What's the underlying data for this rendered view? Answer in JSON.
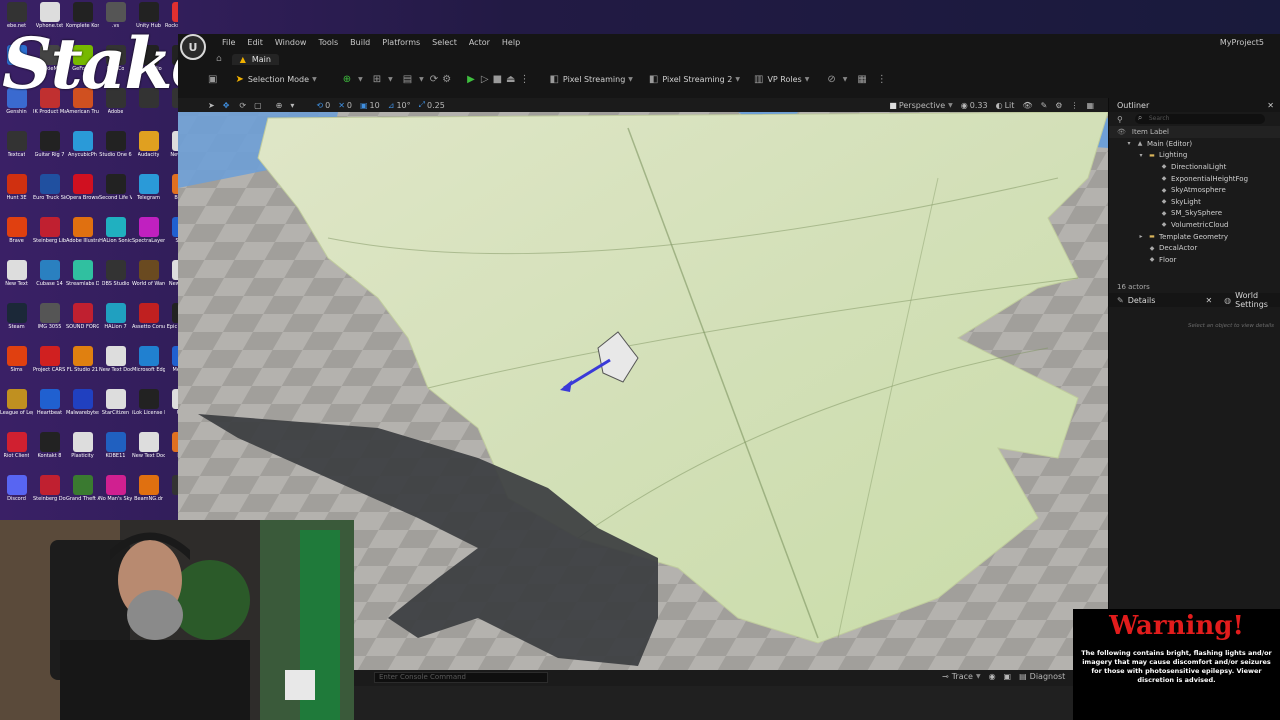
{
  "desktop": {
    "icons": [
      {
        "label": "ebe.net",
        "color": "#333"
      },
      {
        "label": "Vphone.txt",
        "color": "#ddd"
      },
      {
        "label": "Komplete Kontrol",
        "color": "#222"
      },
      {
        "label": ".vs",
        "color": "#555"
      },
      {
        "label": "Unity Hub",
        "color": "#222"
      },
      {
        "label": "Rockstar Games",
        "color": "#e03030"
      },
      {
        "label": "",
        "color": "#2a6fd0"
      },
      {
        "label": "DeskieMin",
        "color": "#444"
      },
      {
        "label": "GeForce",
        "color": "#76b900"
      },
      {
        "label": "DTMCo",
        "color": "#333"
      },
      {
        "label": "GPU Audio",
        "color": "#222"
      },
      {
        "label": "",
        "color": "#222"
      },
      {
        "label": "Genshin",
        "color": "#3a6ad0"
      },
      {
        "label": "IK Product Manager",
        "color": "#c03030"
      },
      {
        "label": "American Truck Si",
        "color": "#d05020"
      },
      {
        "label": "Adobe",
        "color": "#333"
      },
      {
        "label": "",
        "color": "#333"
      },
      {
        "label": "",
        "color": "#333"
      },
      {
        "label": "Textcat",
        "color": "#333"
      },
      {
        "label": "Guitar Rig 7",
        "color": "#222"
      },
      {
        "label": "AnycubicPh",
        "color": "#2a9ad8"
      },
      {
        "label": "Studio One 6",
        "color": "#222"
      },
      {
        "label": "Audacity",
        "color": "#e0a020"
      },
      {
        "label": "New Doc",
        "color": "#ddd"
      },
      {
        "label": "Hunt 3E",
        "color": "#d03010"
      },
      {
        "label": "Euro Truck Simulator 2",
        "color": "#2050a0"
      },
      {
        "label": "Opera Browser",
        "color": "#d01020"
      },
      {
        "label": "Second Life Viewer",
        "color": "#222"
      },
      {
        "label": "Telegram",
        "color": "#2a9ad8"
      },
      {
        "label": "Blend",
        "color": "#e07020"
      },
      {
        "label": "Brave",
        "color": "#e04010"
      },
      {
        "label": "Steinberg Library",
        "color": "#c02030"
      },
      {
        "label": "Adobe Illustrat",
        "color": "#e07010"
      },
      {
        "label": "HALion Sonic",
        "color": "#20b0c0"
      },
      {
        "label": "SpectraLayers 10",
        "color": "#c020c0"
      },
      {
        "label": "Sync",
        "color": "#2060d0"
      },
      {
        "label": "New Text",
        "color": "#ddd"
      },
      {
        "label": "Cubase 14",
        "color": "#2a80c0"
      },
      {
        "label": "Streamlabs Desktop",
        "color": "#30c0a0"
      },
      {
        "label": "OBS Studio",
        "color": "#333"
      },
      {
        "label": "World of Warcra",
        "color": "#6a4a20"
      },
      {
        "label": "New Docu",
        "color": "#ddd"
      },
      {
        "label": "Steam",
        "color": "#1b2838"
      },
      {
        "label": "IMG 3055",
        "color": "#555"
      },
      {
        "label": "SOUND FORGE Audi",
        "color": "#c02030"
      },
      {
        "label": "HALion 7",
        "color": "#20a0c0"
      },
      {
        "label": "Assetto Corsa",
        "color": "#c02020"
      },
      {
        "label": "Epic Games",
        "color": "#222"
      },
      {
        "label": "Sims",
        "color": "#e04010"
      },
      {
        "label": "Project CARS 2",
        "color": "#d02020"
      },
      {
        "label": "FL Studio 21",
        "color": "#e08010"
      },
      {
        "label": "New Text Document",
        "color": "#ddd"
      },
      {
        "label": "Microsoft Edge",
        "color": "#2080d0"
      },
      {
        "label": "Meta Q",
        "color": "#2060d0"
      },
      {
        "label": "League of Legends",
        "color": "#c09020"
      },
      {
        "label": "Heartbeat",
        "color": "#2060d0"
      },
      {
        "label": "Malwarebytes",
        "color": "#2040c0"
      },
      {
        "label": "StarCitizen",
        "color": "#ddd"
      },
      {
        "label": "iLok License Manager",
        "color": "#222"
      },
      {
        "label": "Use",
        "color": "#ddd"
      },
      {
        "label": "Riot Client",
        "color": "#d02030"
      },
      {
        "label": "Kontakt 8",
        "color": "#222"
      },
      {
        "label": "Plasticity",
        "color": "#ddd"
      },
      {
        "label": "KOBE11",
        "color": "#2060c0"
      },
      {
        "label": "New Text Docume",
        "color": "#ddd"
      },
      {
        "label": "File",
        "color": "#e07020"
      },
      {
        "label": "Discord",
        "color": "#5865f2"
      },
      {
        "label": "Steinberg Downlo",
        "color": "#c02030"
      },
      {
        "label": "Grand Theft Auto V",
        "color": "#3a7a30"
      },
      {
        "label": "No Man's Sky",
        "color": "#d02090"
      },
      {
        "label": "BeamNG.dr",
        "color": "#e07010"
      },
      {
        "label": "",
        "color": "#333"
      }
    ],
    "overlay_text": "Stake"
  },
  "editor": {
    "logo": "U",
    "menu": [
      "File",
      "Edit",
      "Window",
      "Tools",
      "Build",
      "Platforms",
      "Select",
      "Actor",
      "Help"
    ],
    "project_name": "MyProject5",
    "tab_main": "Main",
    "toolbar": {
      "selection_mode": "Selection Mode",
      "pixel_streaming": "Pixel Streaming",
      "pixel_streaming_2": "Pixel Streaming 2",
      "vp_roles": "VP Roles"
    },
    "viewport_toolbar": {
      "translate_snap": "0",
      "rotate_snap": "10",
      "rotate_snap_2": "10°",
      "scale_snap": "0.25",
      "perspective": "Perspective",
      "camera_speed": "0.33",
      "lit": "Lit"
    },
    "console": {
      "placeholder": "Enter Console Command",
      "trace": "Trace",
      "diagnostics": "Diagnost"
    }
  },
  "outliner": {
    "title": "Outliner",
    "search_placeholder": "Search",
    "column_label": "Item Label",
    "items": [
      {
        "label": "Main (Editor)",
        "indent": 1,
        "type": "level",
        "expand": "▾"
      },
      {
        "label": "Lighting",
        "indent": 2,
        "type": "folder",
        "expand": "▾"
      },
      {
        "label": "DirectionalLight",
        "indent": 3,
        "type": "actor",
        "expand": ""
      },
      {
        "label": "ExponentialHeightFog",
        "indent": 3,
        "type": "actor",
        "expand": ""
      },
      {
        "label": "SkyAtmosphere",
        "indent": 3,
        "type": "actor",
        "expand": ""
      },
      {
        "label": "SkyLight",
        "indent": 3,
        "type": "actor",
        "expand": ""
      },
      {
        "label": "SM_SkySphere",
        "indent": 3,
        "type": "actor",
        "expand": ""
      },
      {
        "label": "VolumetricCloud",
        "indent": 3,
        "type": "actor",
        "expand": ""
      },
      {
        "label": "Template Geometry",
        "indent": 2,
        "type": "folder",
        "expand": "▸"
      },
      {
        "label": "DecalActor",
        "indent": 2,
        "type": "actor",
        "expand": ""
      },
      {
        "label": "Floor",
        "indent": 2,
        "type": "actor",
        "expand": ""
      }
    ],
    "actor_count": "16 actors"
  },
  "details": {
    "tab_details": "Details",
    "tab_world": "World Settings",
    "hint": "Select an object to view details"
  },
  "warning": {
    "title": "Warning!",
    "body": "The following contains bright, flashing lights and/or imagery that may cause discomfort and/or seizures for those with photosensitive epilepsy. Viewer discretion is advised."
  }
}
